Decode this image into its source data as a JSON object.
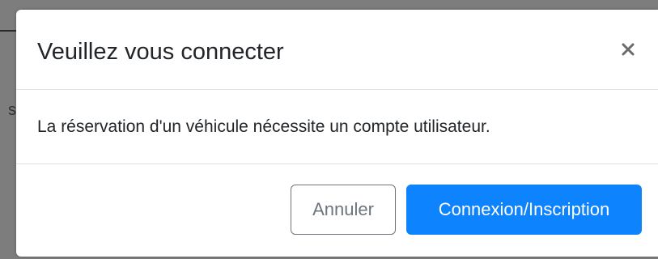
{
  "modal": {
    "title": "Veuillez vous connecter",
    "close_icon": "close-icon",
    "body_text": "La réservation d'un véhicule nécessite un compte utilisateur.",
    "cancel_label": "Annuler",
    "primary_label": "Connexion/Inscription"
  },
  "colors": {
    "primary": "#0d83fd",
    "secondary": "#6c757d",
    "backdrop": "#7d7d7d"
  }
}
